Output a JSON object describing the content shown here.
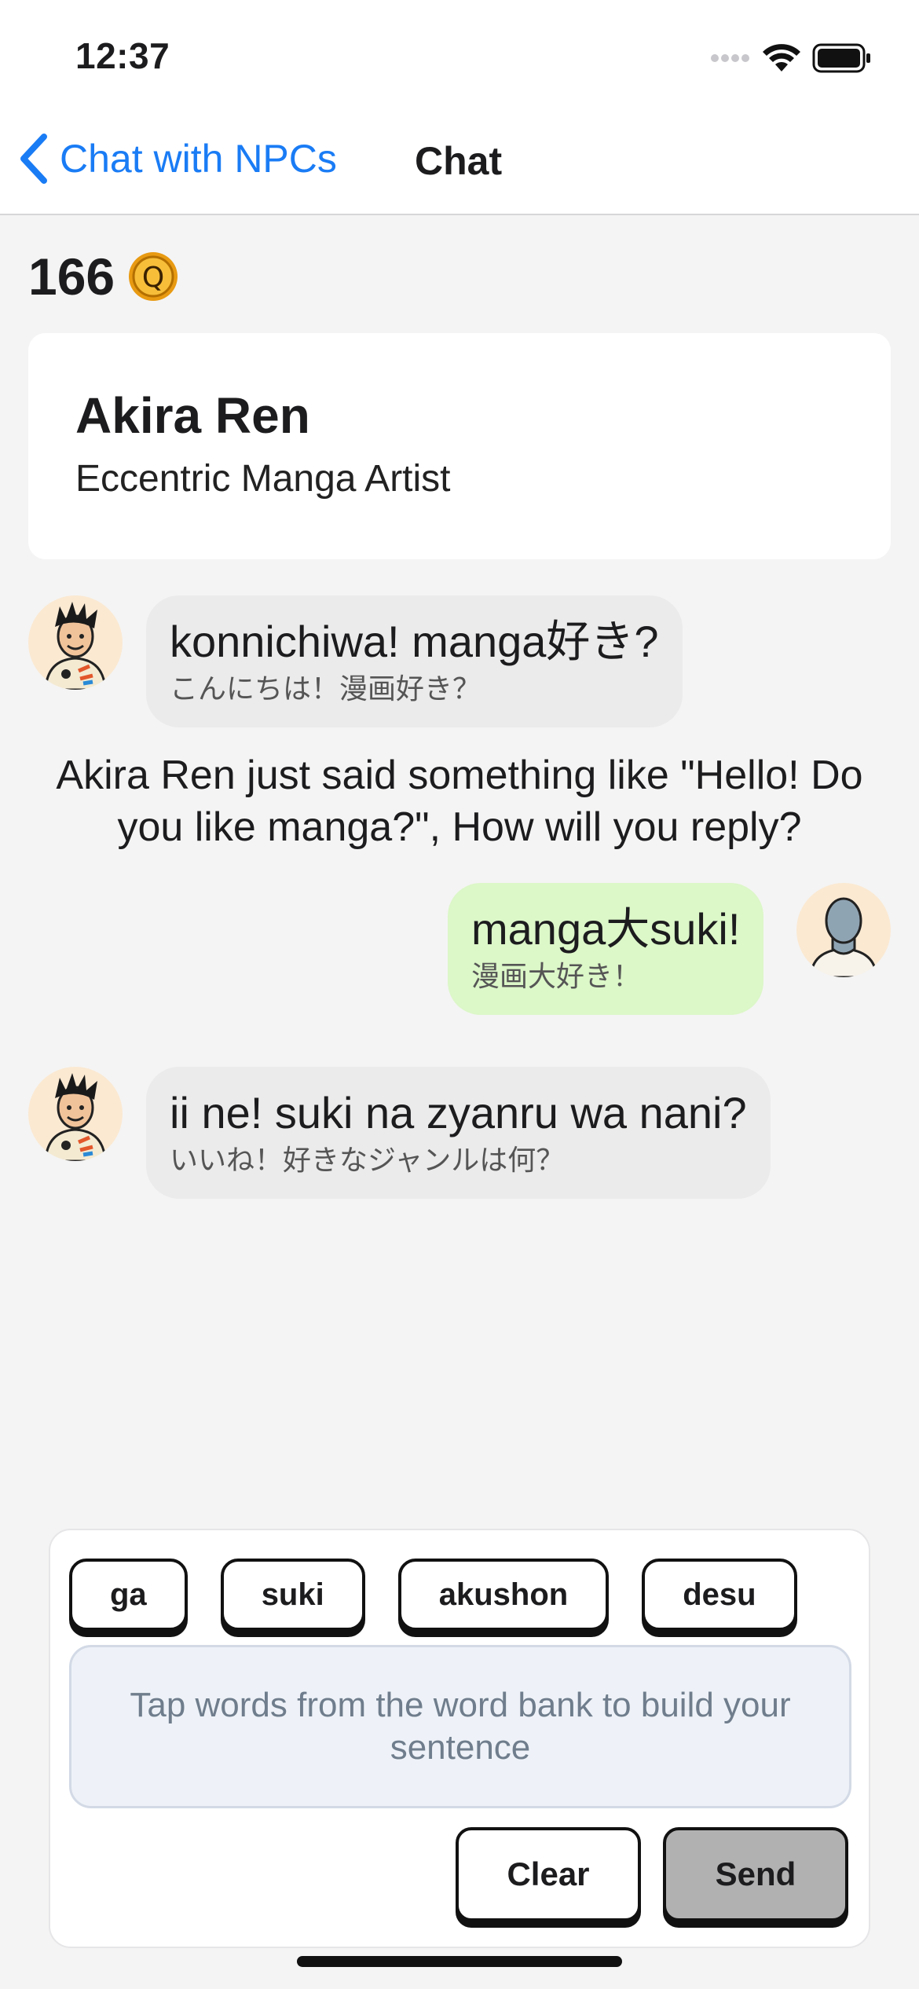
{
  "status_bar": {
    "time": "12:37",
    "icons": [
      "cellular-icon",
      "wifi-icon",
      "battery-icon"
    ]
  },
  "nav": {
    "back_label": "Chat with NPCs",
    "title": "Chat"
  },
  "coins": {
    "count": "166",
    "icon": "coin-q-icon",
    "coin_letter": "Q"
  },
  "character": {
    "name": "Akira Ren",
    "role": "Eccentric Manga Artist"
  },
  "messages": [
    {
      "sender": "npc",
      "text": "konnichiwa! manga好き?",
      "translation": "こんにちは！漫画好き？"
    },
    {
      "sender": "user",
      "text": "manga大suki!",
      "translation": "漫画大好き！"
    },
    {
      "sender": "npc",
      "text": "ii ne! suki na zyanru wa nani?",
      "translation": "いいね！好きなジャンルは何？"
    }
  ],
  "hint": "Akira Ren just said something like \"Hello! Do you like manga?\", How will you reply?",
  "word_bank": [
    "ga",
    "suki",
    "akushon",
    "desu"
  ],
  "sentence": {
    "placeholder": "Tap words from the word bank to build your sentence"
  },
  "buttons": {
    "clear": "Clear",
    "send": "Send"
  },
  "colors": {
    "accent": "#1a7cf5",
    "npc_bubble": "#ebebeb",
    "user_bubble": "#dcf7c8",
    "send_disabled": "#b1b1b1",
    "coin": "#f2a91c"
  }
}
